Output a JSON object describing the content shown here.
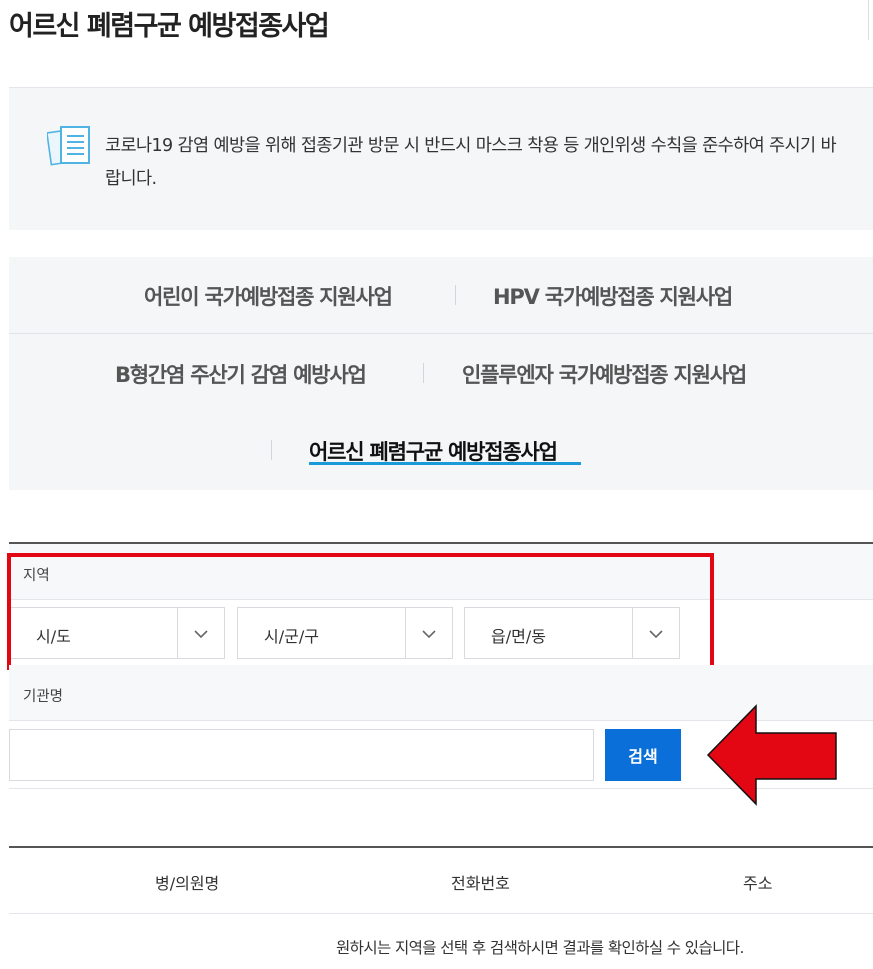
{
  "page": {
    "title": "어르신 폐렴구균 예방접종사업"
  },
  "notice": {
    "icon": "document-list-icon",
    "text": "코로나19 감염 예방을 위해 접종기관 방문 시 반드시 마스크 착용 등 개인위생 수칙을 준수하여 주시기 바랍니다."
  },
  "tabs": [
    {
      "label": "어린이 국가예방접종 지원사업",
      "active": false
    },
    {
      "label": "HPV 국가예방접종 지원사업",
      "active": false
    },
    {
      "label": "B형간염 주산기 감염 예방사업",
      "active": false
    },
    {
      "label": "인플루엔자 국가예방접종 지원사업",
      "active": false
    },
    {
      "label": "어르신 폐렴구균 예방접종사업",
      "active": true
    }
  ],
  "search_form": {
    "region_label": "지역",
    "selects": [
      {
        "value": "시/도",
        "icon": "chevron-down-icon"
      },
      {
        "value": "시/군/구",
        "icon": "chevron-down-icon"
      },
      {
        "value": "읍/면/동",
        "icon": "chevron-down-icon"
      }
    ],
    "org_label": "기관명",
    "org_input_value": "",
    "search_button": "검색"
  },
  "results_table": {
    "columns": [
      "병/의원명",
      "전화번호",
      "주소"
    ],
    "empty_message": "원하시는 지역을 선택 후 검색하시면 결과를 확인하실 수 있습니다."
  },
  "annotations": {
    "highlight_color": "#e30613",
    "arrow_icon": "left-arrow-icon"
  },
  "colors": {
    "accent": "#0a6fd8",
    "tab_underline": "#1a9bd7"
  }
}
